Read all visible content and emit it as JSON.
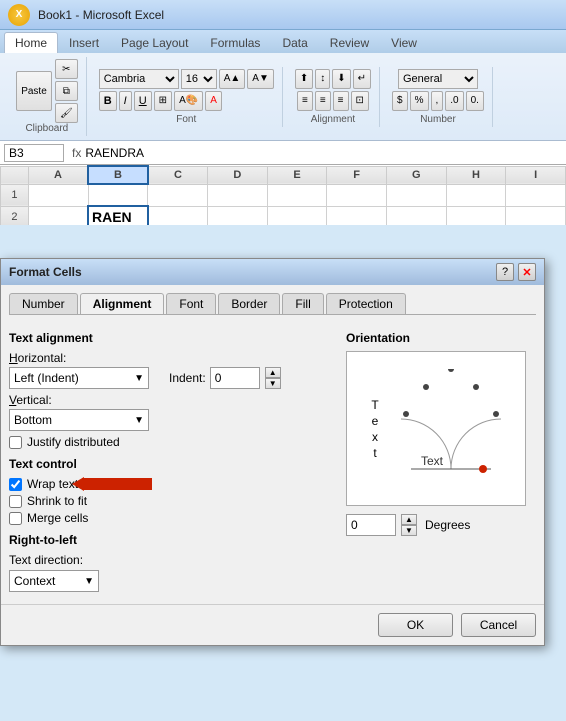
{
  "titlebar": {
    "title": "Book1 - Microsoft Excel",
    "icon": "X"
  },
  "ribbon": {
    "tabs": [
      "Home",
      "Insert",
      "Page Layout",
      "Formulas",
      "Data",
      "Review",
      "View"
    ],
    "active_tab": "Home",
    "font_name": "Cambria",
    "font_size": "16",
    "groups": [
      "Clipboard",
      "Font",
      "Alignment",
      "Number"
    ]
  },
  "formula_bar": {
    "cell_ref": "B3",
    "formula_icon": "fx",
    "value": "RAENDRA"
  },
  "spreadsheet": {
    "columns": [
      "",
      "A",
      "B",
      "C",
      "D",
      "E",
      "F",
      "G",
      "H",
      "I"
    ],
    "rows": [
      {
        "num": "1",
        "cells": [
          "",
          "",
          "",
          "",
          "",
          "",
          "",
          "",
          ""
        ]
      },
      {
        "num": "2",
        "cells": [
          "",
          "RAEN",
          "",
          "",
          "",
          "",
          "",
          "",
          ""
        ]
      }
    ],
    "selected_cell": "B3",
    "cell_value": "RAEN"
  },
  "dialog": {
    "title": "Format Cells",
    "tabs": [
      "Number",
      "Alignment",
      "Font",
      "Border",
      "Fill",
      "Protection"
    ],
    "active_tab": "Alignment",
    "sections": {
      "text_alignment": {
        "title": "Text alignment",
        "horizontal_label": "Horizontal:",
        "horizontal_value": "Left (Indent)",
        "indent_label": "Indent:",
        "indent_value": "0",
        "vertical_label": "Vertical:",
        "vertical_value": "Bottom",
        "justify_distributed": "Justify distributed"
      },
      "text_control": {
        "title": "Text control",
        "wrap_text_label": "Wrap text",
        "wrap_text_checked": true,
        "shrink_to_fit_label": "Shrink to fit",
        "shrink_to_fit_checked": false,
        "merge_cells_label": "Merge cells",
        "merge_cells_checked": false
      },
      "right_to_left": {
        "title": "Right-to-left",
        "text_direction_label": "Text direction:",
        "text_direction_value": "Context"
      }
    },
    "orientation": {
      "title": "Orientation",
      "text_label": "Text",
      "degrees_value": "0",
      "degrees_label": "Degrees"
    },
    "footer": {
      "ok_label": "OK",
      "cancel_label": "Cancel"
    }
  }
}
